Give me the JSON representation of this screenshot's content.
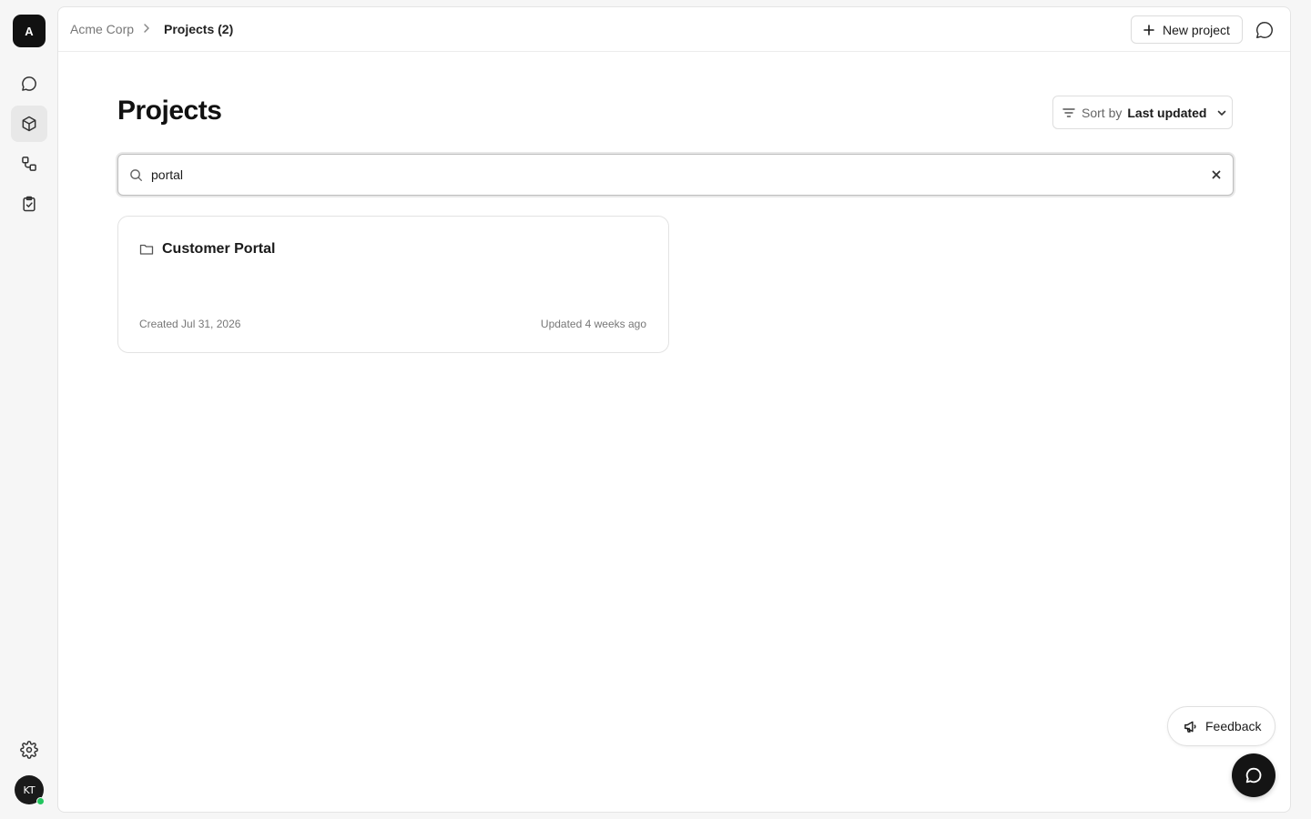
{
  "workspace": {
    "logo_letter": "A"
  },
  "sidebar": {
    "items": [
      {
        "icon": "chat-bubble-icon",
        "active": false
      },
      {
        "icon": "cube-icon",
        "active": true
      },
      {
        "icon": "workflow-icon",
        "active": false
      },
      {
        "icon": "clipboard-check-icon",
        "active": false
      }
    ],
    "settings_icon": "gear-icon",
    "user": {
      "initials": "KT",
      "status_color": "#22c55e"
    }
  },
  "header": {
    "breadcrumb_root": "Acme Corp",
    "breadcrumb_current": "Projects (2)",
    "new_project_label": "New project"
  },
  "main": {
    "title": "Projects",
    "sort": {
      "prefix": "Sort by",
      "value": "Last updated"
    },
    "search": {
      "value": "portal",
      "placeholder": ""
    },
    "projects": [
      {
        "name": "Customer Portal",
        "created": "Created Jul 31, 2026",
        "updated": "Updated 4 weeks ago"
      }
    ]
  },
  "feedback_label": "Feedback",
  "colors": {
    "accent": "#111111",
    "background": "#f6f6f6",
    "online": "#22c55e"
  }
}
